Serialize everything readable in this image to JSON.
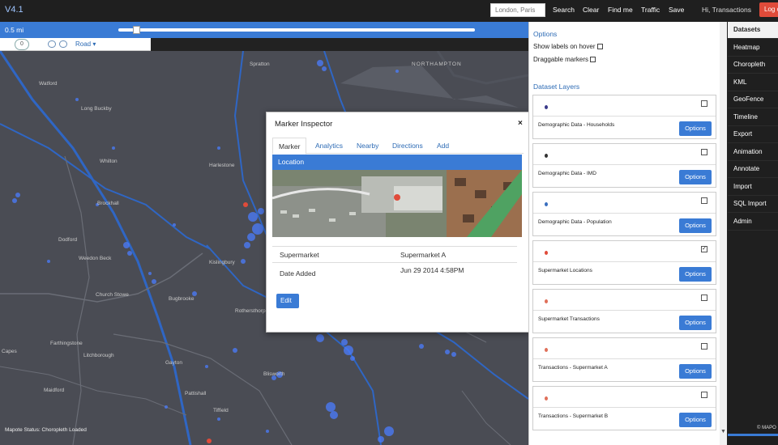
{
  "app": {
    "version": "V4.1"
  },
  "topbar": {
    "search_placeholder": "London, Paris",
    "buttons": [
      "Search",
      "Clear",
      "Find me",
      "Traffic",
      "Save"
    ],
    "greeting": "Hi, Transactions",
    "logout": "Log o"
  },
  "distance": {
    "label": "0.5 mi",
    "slider_level": 0.04
  },
  "map_controls": {
    "zoom": "0",
    "basemap": "Road ▾"
  },
  "map": {
    "towns": [
      "Watford",
      "Long Buckby",
      "Whilton",
      "Brockhall",
      "Weedon Beck",
      "Church Stowe",
      "Farthingstone",
      "Litchborough",
      "Maidford",
      "Bugbrooke",
      "Kislingbury",
      "Rothersthorpe",
      "Blisworth",
      "Tiffield",
      "Harlestone",
      "Spratton",
      "NORTHAMPTON",
      "Dodford",
      "Capes",
      "Gayton",
      "Pattishall"
    ],
    "status": "Mapote Status: Choropleth Loaded"
  },
  "inspector": {
    "title": "Marker Inspector",
    "close": "×",
    "tabs": [
      "Marker",
      "Analytics",
      "Nearby",
      "Directions",
      "Add"
    ],
    "section": "Location",
    "rows": [
      {
        "label": "Supermarket",
        "value": "Supermarket A"
      },
      {
        "label": "Date Added",
        "value": "Jun 29 2014 4:58PM"
      }
    ],
    "edit": "Edit"
  },
  "panel": {
    "options_head": "Options",
    "options": [
      "Show labels on hover",
      "Draggable markers"
    ],
    "datasets_head": "Dataset Layers",
    "datasets": [
      {
        "name": "Demographic Data - Households",
        "checked": false,
        "color": "#3a3a8a"
      },
      {
        "name": "Demographic Data - IMD",
        "checked": false,
        "color": "#333333"
      },
      {
        "name": "Demographic Data - Population",
        "checked": false,
        "color": "#3a6fbf"
      },
      {
        "name": "Supermarket Locations",
        "checked": true,
        "color": "#e04b3a"
      },
      {
        "name": "Supermarket Transactions",
        "checked": false,
        "color": "#e0705a"
      },
      {
        "name": "Transactions - Supermarket A",
        "checked": false,
        "color": "#e0705a"
      },
      {
        "name": "Transactions - Supermarket B",
        "checked": false,
        "color": "#e0705a"
      }
    ],
    "options_button": "Options",
    "checkmark": "✓"
  },
  "nav": {
    "items": [
      "Datasets",
      "Heatmap",
      "Choropleth",
      "KML",
      "GeoFence",
      "Timeline",
      "Export",
      "Animation",
      "Annotate",
      "Import",
      "SQL Import",
      "Admin"
    ],
    "copyright": "© MAPO"
  },
  "colors": {
    "accent": "#3a7bd5",
    "danger": "#e04b3a",
    "heat": "#4a7dff"
  }
}
